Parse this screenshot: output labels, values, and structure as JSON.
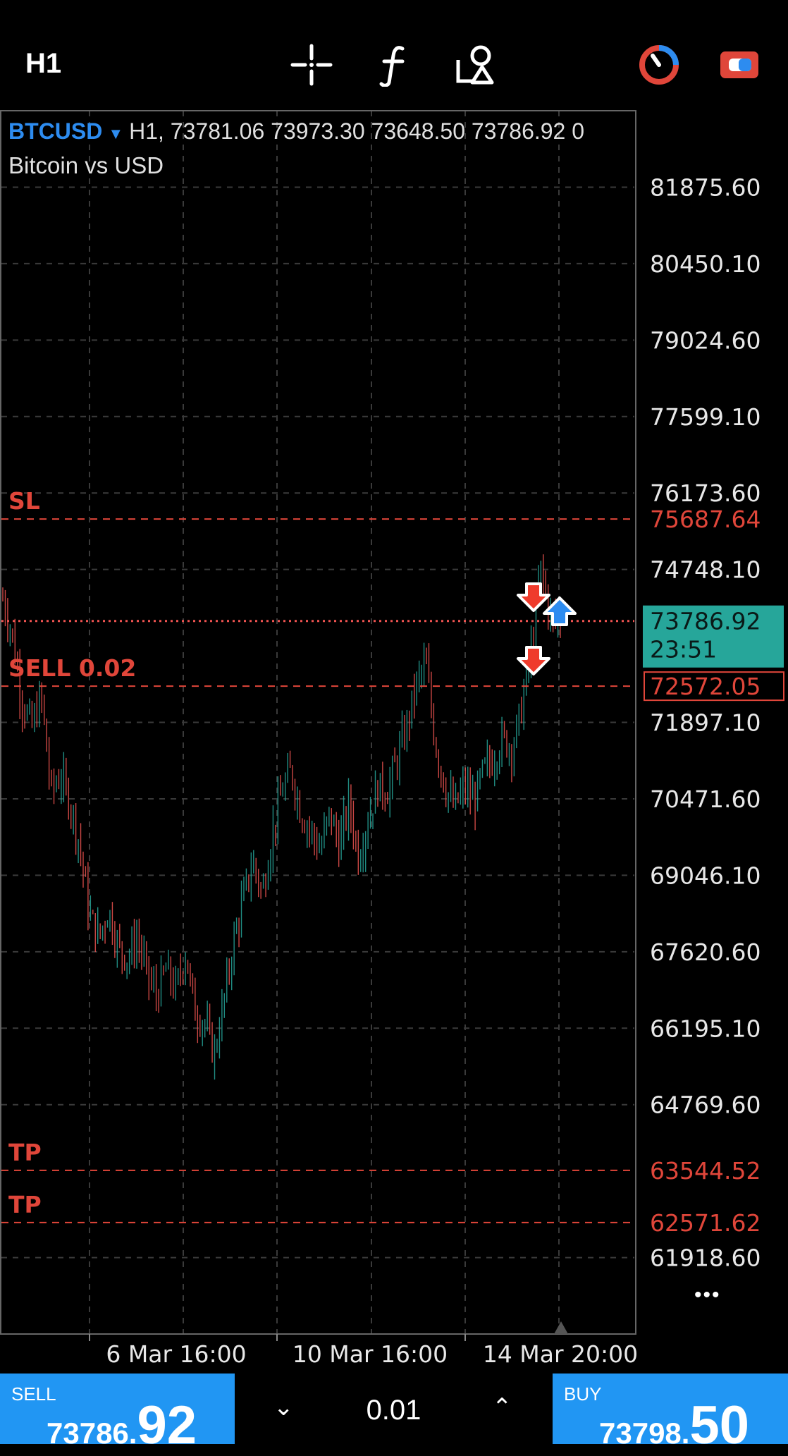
{
  "toolbar": {
    "timeframe": "H1",
    "icons": [
      "crosshair-icon",
      "indicators-f-icon",
      "objects-icon",
      "clock-icon",
      "trade-toggle-icon"
    ]
  },
  "chart_header": {
    "symbol": "BTCUSD",
    "dropdown": "▼",
    "values": "H1, 73781.06 73973.30 73648.50 73786.92 0",
    "description": "Bitcoin vs USD"
  },
  "chart_data": {
    "type": "candlestick",
    "symbol": "BTCUSD",
    "timeframe": "H1",
    "ylim": [
      60493.1,
      83301.1
    ],
    "y_ticks": [
      "81875.60",
      "80450.10",
      "79024.60",
      "77599.10",
      "76173.60",
      "74748.10",
      "71897.10",
      "70471.60",
      "69046.10",
      "67620.60",
      "66195.10",
      "64769.60",
      "61918.60"
    ],
    "x_ticks": [
      "6 Mar 16:00",
      "10 Mar 16:00",
      "14 Mar 20:00"
    ],
    "close_path": [
      74200,
      73500,
      72300,
      71800,
      72400,
      70600,
      70900,
      70400,
      69600,
      68300,
      67900,
      68400,
      67700,
      67500,
      67900,
      67200,
      66800,
      67300,
      66900,
      67600,
      66500,
      66300,
      65700,
      66700,
      67800,
      68600,
      69300,
      68700,
      69800,
      70600,
      71000,
      70200,
      69900,
      69500,
      70200,
      69600,
      70400,
      69400,
      70100,
      70700,
      70600,
      71200,
      71800,
      72600,
      73000,
      71500,
      70700,
      70300,
      70700,
      70400,
      71000,
      71200,
      71600,
      71400,
      72200,
      73300,
      74800,
      73800,
      73786.92
    ],
    "current_price": "73786.92",
    "countdown": "23:51",
    "levels": [
      {
        "label": "SL",
        "price": "75687.64",
        "color": "#e0463a"
      },
      {
        "label": "SELL 0.02",
        "price": "72572.05",
        "color": "#e0463a"
      },
      {
        "label": "TP",
        "price": "63544.52",
        "color": "#e0463a"
      },
      {
        "label": "TP",
        "price": "62571.62",
        "color": "#e0463a"
      }
    ],
    "more": "•••"
  },
  "colors": {
    "background": "#000000",
    "accent": "#2196f3",
    "bull": "#26a69a",
    "bear": "#ef5350",
    "level": "#e0463a",
    "current": "#26a69a"
  },
  "trade": {
    "sell_label": "SELL",
    "sell_price_small": "73786.",
    "sell_price_big": "92",
    "buy_label": "BUY",
    "buy_price_small": "73798.",
    "buy_price_big": "50",
    "lot": "0.01",
    "lot_down": "⌄",
    "lot_up": "⌃"
  }
}
